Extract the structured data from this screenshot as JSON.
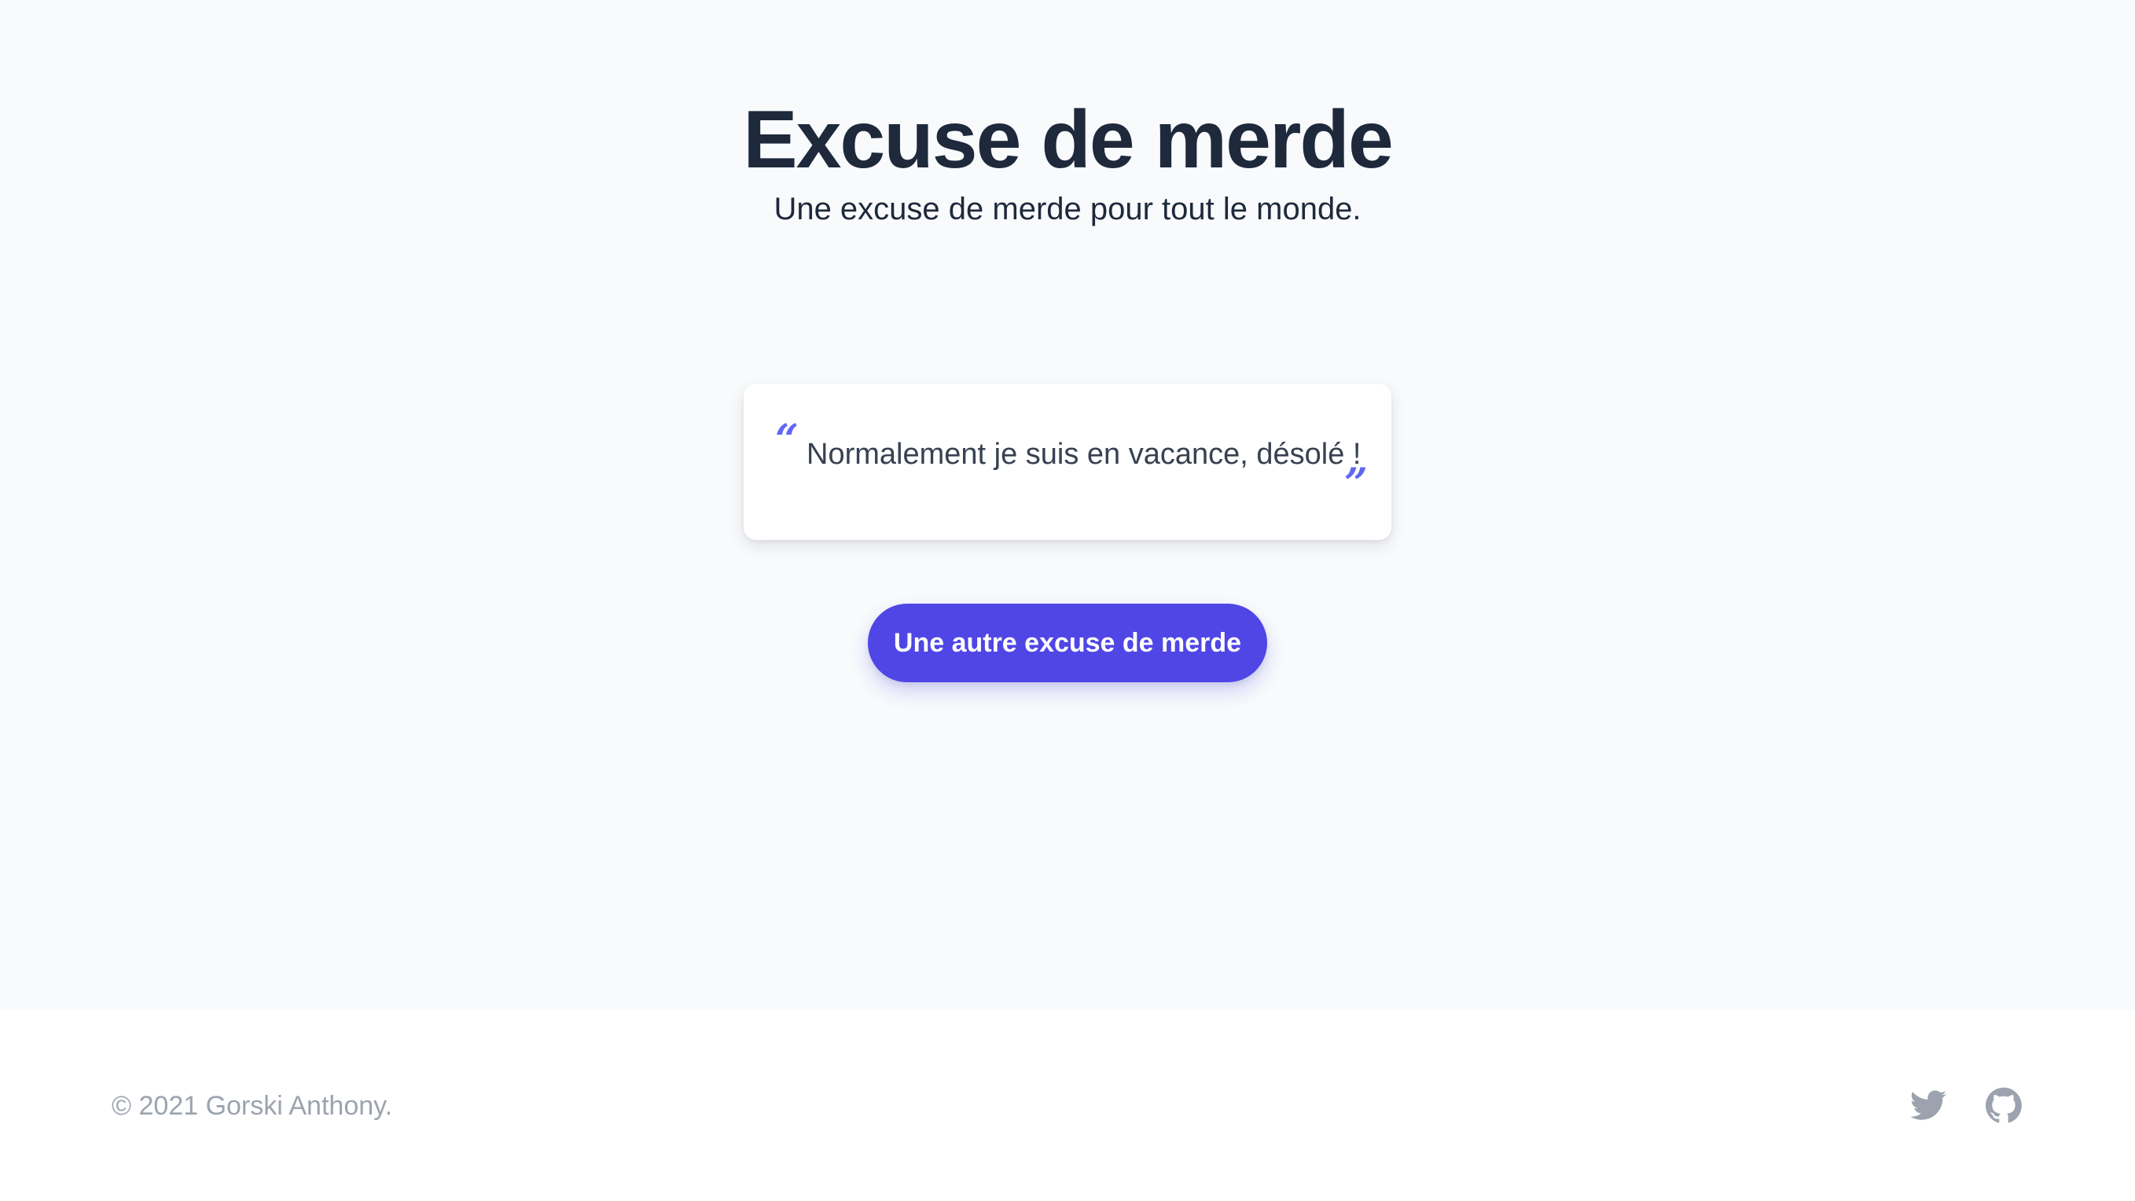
{
  "header": {
    "title": "Excuse de merde",
    "subtitle": "Une excuse de merde pour tout le monde."
  },
  "quote": {
    "open_mark": "“",
    "close_mark": "”",
    "text": "Normalement je suis en vacance, désolé !"
  },
  "actions": {
    "another_excuse_label": "Une autre excuse de merde"
  },
  "footer": {
    "copyright": "© 2021 Gorski Anthony.",
    "social": [
      {
        "icon": "twitter-icon"
      },
      {
        "icon": "github-icon"
      }
    ]
  },
  "colors": {
    "accent": "#4f46e5",
    "quote_mark": "#6366f1",
    "heading": "#1e293b",
    "muted": "#9ca3af",
    "background": "#f8fafc"
  }
}
